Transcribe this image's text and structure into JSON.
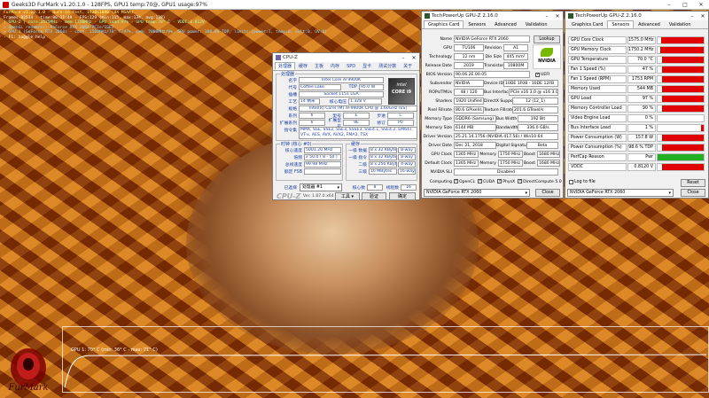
{
  "furmark": {
    "title": "Geeks3D FurMark v1.20.1.0 - 128FPS, GPU1 temp:70@, GPU1 usage:97%",
    "overlay": [
      {
        "text": "FurMark v1.20.1.0 - Burn-in test, 1920x1080 (8X MSAA)",
        "cls": "y"
      },
      {
        "text": "Frames:82534 - time:00:11:49 - FPS:129 (min:115, max:134, avg:128)",
        "cls": ""
      },
      {
        "text": "[ GPU-Z ] core:1575MHz - mem:1750MHz - GPU load:97% - GPU temp:70° C - VDDC:0.812V",
        "cls": "g"
      },
      {
        "text": "> OpenGL renderer: GeForce RTX 2060/PCIe/SSE2",
        "cls": "c"
      },
      {
        "text": "> GPU 1 (GeForce RTX 2060) - core: 1560MHz/70° C/97%, mem: 7000MHz/9%, GPU power: 100.6% TDP, limits:[power:1, temp:0, volt:0, OV:0]",
        "cls": "c"
      },
      {
        "text": "- F1: toggle help",
        "cls": ""
      }
    ],
    "graph_label": "GPU 1: 70° C (min: 36° C - max: 71° C)",
    "logo_text": "FurMark"
  },
  "cpuz": {
    "title": "CPU-Z",
    "tabs": [
      "处理器",
      "缓存",
      "主板",
      "内存",
      "SPD",
      "显卡",
      "测试分数",
      "关于"
    ],
    "active_tab": 0,
    "group_processor": "处理器",
    "fields": {
      "name_label": "名字",
      "name": "Intel Core i9 9900K",
      "codename_label": "代号",
      "codename": "Coffee Lake",
      "tdp_label": "TDP",
      "tdp": "95.0 W",
      "package_label": "插槽",
      "package": "Socket 1151 LGA",
      "tech_label": "工艺",
      "tech": "14 纳米",
      "voltage_label": "核心电压",
      "voltage": "1.328 V",
      "spec_label": "规格",
      "spec": "Intel(R) Core(TM) i9-9900K CPU @ 3.60GHz (ES)",
      "family_label": "系列",
      "family": "6",
      "model_label": "型号",
      "model": "E",
      "stepping_label": "步进",
      "stepping": "C",
      "extfamily_label": "扩展系列",
      "extfamily": "6",
      "extmodel_label": "扩展型号",
      "extmodel": "9E",
      "revision_label": "修订",
      "revision": "P0",
      "instr_label": "指令集",
      "instr": "MMX, SSE, SSE2, SSE3, SSSE3, SSE4.1, SSE4.2, EM64T, VT-x, AES, AVX, AVX2, FMA3, TSX"
    },
    "clocks_title": "时钟 (核心 #0)",
    "core_speed_label": "核心速度",
    "core_speed": "5001.20 MHz",
    "multiplier_label": "倍频",
    "multiplier": "x 50.0 ( 8 - 50 )",
    "bus_label": "总线速度",
    "bus": "99.98 MHz",
    "fsb_label": "额定 FSB",
    "fsb": "",
    "cache_title": "缓存",
    "cache": [
      {
        "label": "一级 数据",
        "size": "8 x 32 KBytes",
        "way": "8-way"
      },
      {
        "label": "一级 指令",
        "size": "8 x 32 KBytes",
        "way": "8-way"
      },
      {
        "label": "二级",
        "size": "8 x 256 KBytes",
        "way": "4-way"
      },
      {
        "label": "三级",
        "size": "16 MBytes",
        "way": "16-way"
      }
    ],
    "selected_label": "已选择",
    "selected": "处理器 #1",
    "cores_label": "核心数",
    "cores": "8",
    "threads_label": "线程数",
    "threads": "16",
    "brand": "CPU-Z",
    "version": "Ver. 1.87.0.x64",
    "tools_button": "工具",
    "validate_button": "验证",
    "ok_button": "确定",
    "logo_text": "CORE i9",
    "logo_sub": "intel"
  },
  "gpuz_card": {
    "title": "TechPowerUp GPU-Z 2.16.0",
    "tabs": [
      "Graphics Card",
      "Sensors",
      "Advanced",
      "Validation"
    ],
    "active_tab": 0,
    "name_label": "Name",
    "name": "NVIDIA GeForce RTX 2060",
    "lookup": "Lookup",
    "gpu_label": "GPU",
    "gpu": "TU106",
    "revision_label": "Revision",
    "revision": "A1",
    "tech_label": "Technology",
    "tech": "12 nm",
    "diesize_label": "Die Size",
    "diesize": "445 mm²",
    "release_label": "Release Date",
    "release": "2019",
    "transistors_label": "Transistors",
    "transistors": "10800M",
    "bios_label": "BIOS Version",
    "bios": "90.06.2E.00.05",
    "uefi_label": "UEFI",
    "subvendor_label": "Subvendor",
    "subvendor": "NVIDIA",
    "deviceid_label": "Device ID",
    "deviceid": "10DE 1F08 - 10DE 12FB",
    "rops_label": "ROPs/TMUs",
    "rops": "48 / 120",
    "businterface_label": "Bus Interface",
    "businterface": "PCIe x16 3.0 @ x16 3.0",
    "shaders_label": "Shaders",
    "shaders": "1920 Unified",
    "directx_label": "DirectX Support",
    "directx": "12 (12_1)",
    "pixel_label": "Pixel Fillrate",
    "pixel": "80.6 GPixel/s",
    "texture_label": "Texture Fillrate",
    "texture": "201.6 GTexel/s",
    "memtype_label": "Memory Type",
    "memtype": "GDDR6 (Samsung)",
    "buswidth_label": "Bus Width",
    "buswidth": "192 Bit",
    "memsize_label": "Memory Size",
    "memsize": "6144 MB",
    "bandwidth_label": "Bandwidth",
    "bandwidth": "336.0 GB/s",
    "driver_label": "Driver Version",
    "driver": "25.21.14.1756 (NVIDIA 417.56) / Win10 64",
    "driverdate_label": "Driver Date",
    "driverdate": "Dec 21, 2018",
    "digsig_label": "Digital Signature",
    "digsig": "Beta",
    "gpuclock_label": "GPU Clock",
    "gpuclock": "1365 MHz",
    "mem1_label": "Memory",
    "mem1": "1750 MHz",
    "boost1_label": "Boost",
    "boost1": "1680 MHz",
    "defclock_label": "Default Clock",
    "defclock": "1365 MHz",
    "mem2_label": "Memory",
    "mem2": "1750 MHz",
    "boost2_label": "Boost",
    "boost2": "1680 MHz",
    "sli_label": "NVIDIA SLI",
    "sli": "Disabled",
    "computing_label": "Computing",
    "computing": [
      "OpenCL",
      "CUDA",
      "PhysX",
      "DirectCompute 5.0"
    ],
    "selected_gpu": "NVIDIA GeForce RTX 2060",
    "close_button": "Close",
    "logo_text": "NVIDIA"
  },
  "gpuz_sensors": {
    "title": "TechPowerUp GPU-Z 2.16.0",
    "tabs": [
      "Graphics Card",
      "Sensors",
      "Advanced",
      "Validation"
    ],
    "active_tab": 1,
    "sensors": [
      {
        "name": "GPU Core Clock",
        "value": "1575.0 MHz",
        "fill": 0.92,
        "color": "#e00000"
      },
      {
        "name": "GPU Memory Clock",
        "value": "1750.2 MHz",
        "fill": 0.95,
        "color": "#e00000"
      },
      {
        "name": "GPU Temperature",
        "value": "70.0 °C",
        "fill": 0.9,
        "color": "#e00000"
      },
      {
        "name": "Fan 1 Speed (%)",
        "value": "47 %",
        "fill": 0.9,
        "color": "#e00000"
      },
      {
        "name": "Fan 1 Speed (RPM)",
        "value": "1753 RPM",
        "fill": 0.9,
        "color": "#e00000"
      },
      {
        "name": "Memory Used",
        "value": "544 MB",
        "fill": 0.9,
        "color": "#e00000"
      },
      {
        "name": "GPU Load",
        "value": "97 %",
        "fill": 0.9,
        "color": "#e00000"
      },
      {
        "name": "Memory Controller Load",
        "value": "90 %",
        "fill": 0.9,
        "color": "#e00000"
      },
      {
        "name": "Video Engine Load",
        "value": "0 %",
        "fill": 0,
        "color": "#e00000"
      },
      {
        "name": "Bus Interface Load",
        "value": "1 %",
        "fill": 0.05,
        "color": "#e00000"
      },
      {
        "name": "Power Consumption (W)",
        "value": "157.8 W",
        "fill": 0.9,
        "color": "#e00000"
      },
      {
        "name": "Power Consumption (%)",
        "value": "98.6 % TDP",
        "fill": 0.9,
        "color": "#e00000"
      },
      {
        "name": "PerfCap Reason",
        "value": "Pwr",
        "fill": 1.0,
        "color": "#22b022"
      },
      {
        "name": "VDDC",
        "value": "0.8120 V",
        "fill": 0.9,
        "color": "#e00000"
      }
    ],
    "log_label": "Log to file",
    "reset_button": "Reset",
    "selected_gpu": "NVIDIA GeForce RTX 2060",
    "close_button": "Close"
  }
}
